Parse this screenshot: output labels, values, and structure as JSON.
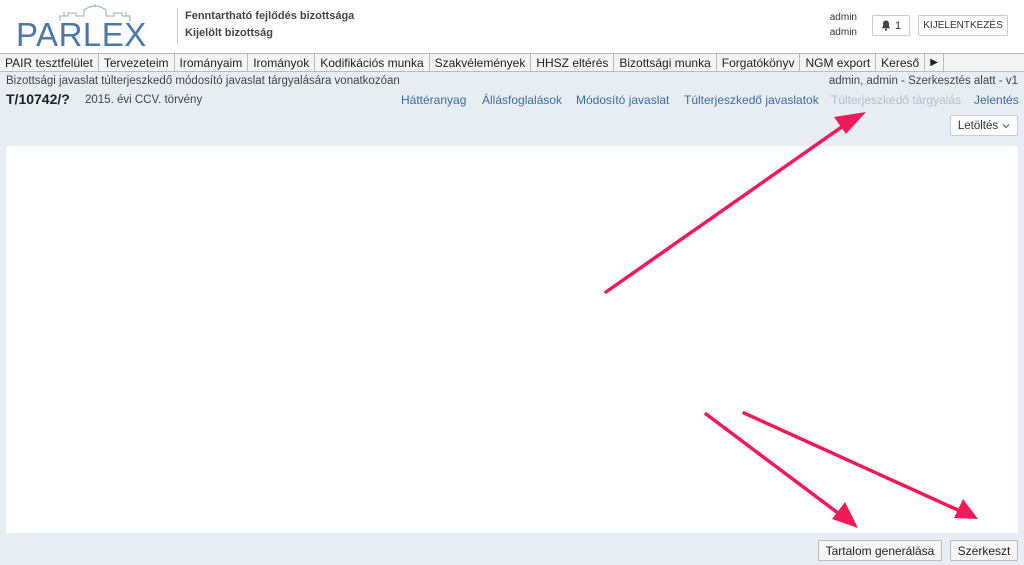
{
  "header": {
    "logo_text": "PARLEX",
    "committee_line1": "Fenntartható fejlődés bizottsága",
    "committee_line2": "Kijelölt bizottság",
    "user_line1": "admin",
    "user_line2": "admin",
    "notification_count": "1",
    "logout_label": "KIJELENTKEZÉS"
  },
  "menu": {
    "items": [
      "PAIR tesztfelület",
      "Tervezeteim",
      "Irományaim",
      "Irományok",
      "Kodifikációs munka",
      "Szakvélemények",
      "HHSZ eltérés",
      "Bizottsági munka",
      "Forgatókönyv",
      "NGM export",
      "Kereső"
    ],
    "more_icon": "▶"
  },
  "document": {
    "title": "Bizottsági javaslat túlterjeszkedő módosító javaslat tárgyalására vonatkozóan",
    "status": "admin, admin - Szerkesztés alatt - v1",
    "id": "T/10742/?",
    "subtitle": "2015. évi CCV. törvény"
  },
  "nav": {
    "links": [
      "Háttéranyag",
      "Állásfoglalások",
      "Módosító javaslat",
      "Túlterjeszkedő javaslatok",
      "Túlterjeszkedő tárgyalás",
      "Jelentés"
    ],
    "active_disabled_index": 4
  },
  "toolbar": {
    "download_label": "Letöltés"
  },
  "footer": {
    "generate_label": "Tartalom generálása",
    "edit_label": "Szerkeszt"
  },
  "colors": {
    "link": "#3a6ea5",
    "annotation_arrow": "#f0195a",
    "logo": "#4a78ad"
  }
}
